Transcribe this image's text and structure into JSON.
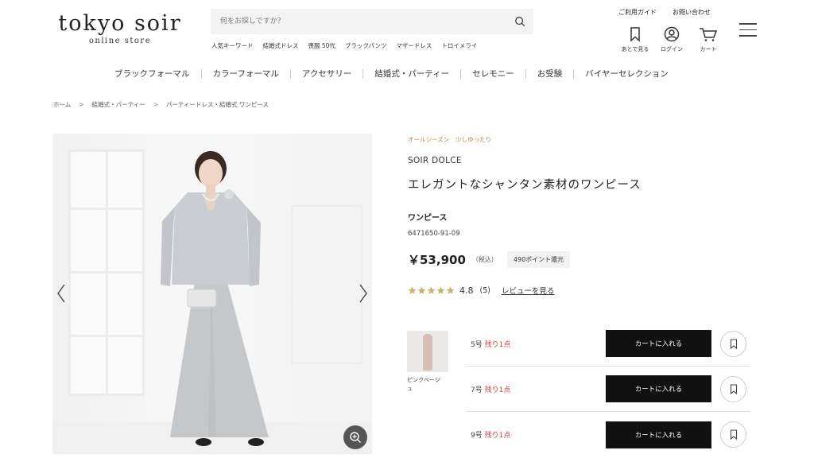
{
  "header": {
    "logo_main": "tokyo soir",
    "logo_sub": "online store",
    "search_placeholder": "何をお探しですか？",
    "keywords_label": "人気キーワード",
    "keywords": [
      "結婚式ドレス",
      "喪服 50代",
      "ブラックパンツ",
      "マザードレス",
      "トロイメライ"
    ],
    "util_links": [
      "ご利用ガイド",
      "お問い合わせ"
    ],
    "icons": [
      {
        "name": "bookmark-icon",
        "label": "あとで見る"
      },
      {
        "name": "user-icon",
        "label": "ログイン"
      },
      {
        "name": "cart-icon",
        "label": "カート"
      }
    ]
  },
  "nav": {
    "categories": [
      "ブラックフォーマル",
      "カラーフォーマル",
      "アクセサリー",
      "結婚式・パーティー",
      "セレモニー",
      "お受験",
      "バイヤーセレクション"
    ]
  },
  "breadcrumb": [
    "ホーム",
    "結婚式・パーティー",
    "パーティードレス・結婚式 ワンピース"
  ],
  "product": {
    "tags": [
      "オールシーズン",
      "少しゆったり"
    ],
    "brand": "SOIR DOLCE",
    "title": "エレガントなシャンタン素材のワンピース",
    "category": "ワンピース",
    "sku": "6471650-91-09",
    "price": "￥53,900",
    "tax": "（税込）",
    "points": "490ポイント還元",
    "rating": "4.8",
    "rating_stars": 5,
    "review_count": "(5)",
    "review_link": "レビューを見る"
  },
  "variant": {
    "color_label": "ピンクベージュ"
  },
  "sizes": [
    {
      "size": "5号",
      "stock": "残り1点",
      "button": "カートに入れる"
    },
    {
      "size": "7号",
      "stock": "残り1点",
      "button": "カートに入れる"
    },
    {
      "size": "9号",
      "stock": "残り1点",
      "button": "カートに入れる"
    }
  ],
  "colors": {
    "accent_gold": "#b08a3c",
    "stock_red": "#d04040",
    "button_black": "#111111",
    "star_color": "#c9b36a"
  }
}
